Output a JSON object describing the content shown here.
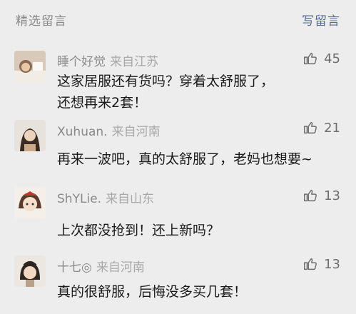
{
  "header": {
    "title": "精选留言",
    "write_label": "写留言"
  },
  "comments": [
    {
      "name": "睡个好觉",
      "location": "来自江苏",
      "likes": "45",
      "lines": [
        "这家居服还有货吗？穿着太舒服了，",
        "还想再来2套！"
      ]
    },
    {
      "name": "Xuhuan.",
      "location": "来自河南",
      "likes": "21",
      "lines": [
        "再来一波吧，真的太舒服了，老妈也想要~"
      ]
    },
    {
      "name": "ShYLie.",
      "location": "来自山东",
      "likes": "13",
      "lines": [
        "上次都没抢到！还上新吗？"
      ]
    },
    {
      "name": "十七◎",
      "location": "来自河南",
      "likes": "13",
      "lines": [
        "真的很舒服，后悔没多买几套！"
      ]
    }
  ],
  "icons": {
    "like": "thumbs-up-icon",
    "avatar": "avatar-photo"
  }
}
